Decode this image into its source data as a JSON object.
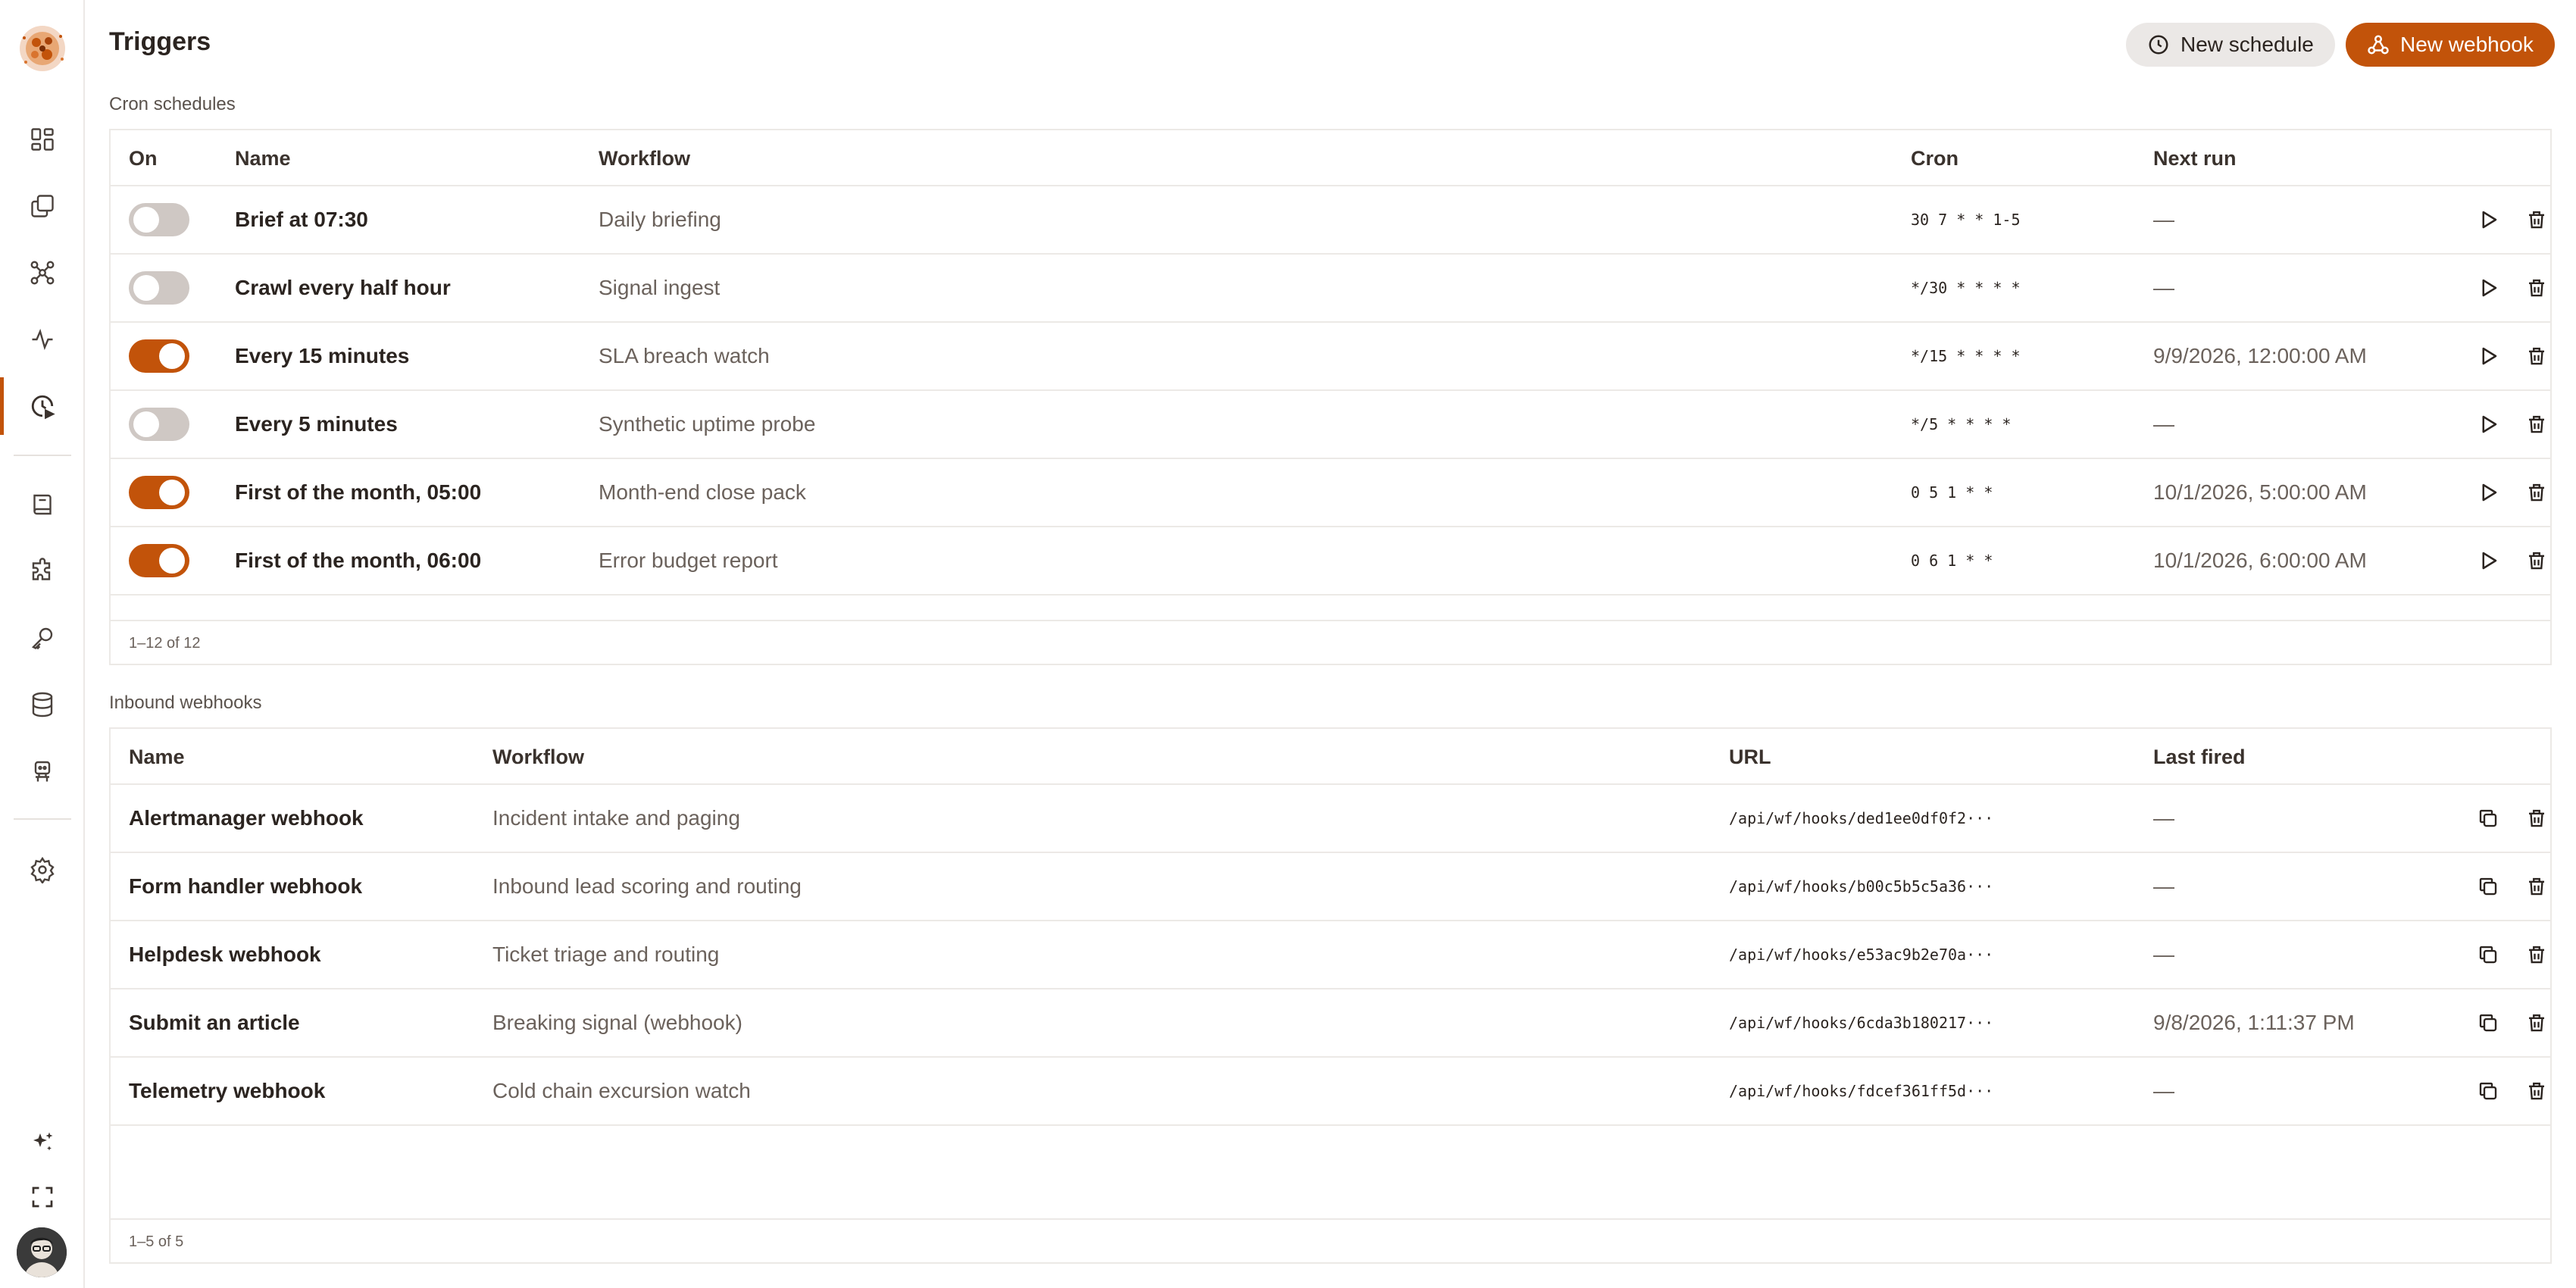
{
  "app": {
    "title": "Triggers",
    "accent_color": "#c2530a"
  },
  "sidebar": {
    "items": [
      {
        "icon": "dashboard-icon",
        "active": false
      },
      {
        "icon": "files-icon",
        "active": false
      },
      {
        "icon": "workflow-graph-icon",
        "active": false
      },
      {
        "icon": "activity-icon",
        "active": false
      },
      {
        "icon": "clock-trigger-icon",
        "active": true
      },
      {
        "icon": "book-icon",
        "active": false
      },
      {
        "icon": "puzzle-icon",
        "active": false
      },
      {
        "icon": "key-icon",
        "active": false
      },
      {
        "icon": "database-icon",
        "active": false
      },
      {
        "icon": "robot-icon",
        "active": false
      },
      {
        "icon": "gear-icon",
        "active": false
      }
    ],
    "bottom": [
      "sparkles-icon",
      "fullscreen-icon",
      "avatar"
    ]
  },
  "header": {
    "new_schedule_label": "New schedule",
    "new_webhook_label": "New webhook"
  },
  "cron": {
    "section_label": "Cron schedules",
    "columns": {
      "on": "On",
      "name": "Name",
      "workflow": "Workflow",
      "cron": "Cron",
      "next_run": "Next run"
    },
    "rows": [
      {
        "on": false,
        "name": "Brief at 07:30",
        "workflow": "Daily briefing",
        "cron": "30 7 * * 1-5",
        "next_run": "—"
      },
      {
        "on": false,
        "name": "Crawl every half hour",
        "workflow": "Signal ingest",
        "cron": "*/30 * * * *",
        "next_run": "—"
      },
      {
        "on": true,
        "name": "Every 15 minutes",
        "workflow": "SLA breach watch",
        "cron": "*/15 * * * *",
        "next_run": "9/9/2026, 12:00:00 AM"
      },
      {
        "on": false,
        "name": "Every 5 minutes",
        "workflow": "Synthetic uptime probe",
        "cron": "*/5 * * * *",
        "next_run": "—"
      },
      {
        "on": true,
        "name": "First of the month, 05:00",
        "workflow": "Month-end close pack",
        "cron": "0 5 1 * *",
        "next_run": "10/1/2026, 5:00:00 AM"
      },
      {
        "on": true,
        "name": "First of the month, 06:00",
        "workflow": "Error budget report",
        "cron": "0 6 1 * *",
        "next_run": "10/1/2026, 6:00:00 AM"
      }
    ],
    "pager": "1–12 of 12"
  },
  "webhooks": {
    "section_label": "Inbound webhooks",
    "columns": {
      "name": "Name",
      "workflow": "Workflow",
      "url": "URL",
      "last_fired": "Last fired"
    },
    "rows": [
      {
        "name": "Alertmanager webhook",
        "workflow": "Incident intake and paging",
        "url": "/api/wf/hooks/ded1ee0df0f2···",
        "last_fired": "—"
      },
      {
        "name": "Form handler webhook",
        "workflow": "Inbound lead scoring and routing",
        "url": "/api/wf/hooks/b00c5b5c5a36···",
        "last_fired": "—"
      },
      {
        "name": "Helpdesk webhook",
        "workflow": "Ticket triage and routing",
        "url": "/api/wf/hooks/e53ac9b2e70a···",
        "last_fired": "—"
      },
      {
        "name": "Submit an article",
        "workflow": "Breaking signal (webhook)",
        "url": "/api/wf/hooks/6cda3b180217···",
        "last_fired": "9/8/2026, 1:11:37 PM"
      },
      {
        "name": "Telemetry webhook",
        "workflow": "Cold chain excursion watch",
        "url": "/api/wf/hooks/fdcef361ff5d···",
        "last_fired": "—"
      }
    ],
    "pager": "1–5 of 5"
  }
}
